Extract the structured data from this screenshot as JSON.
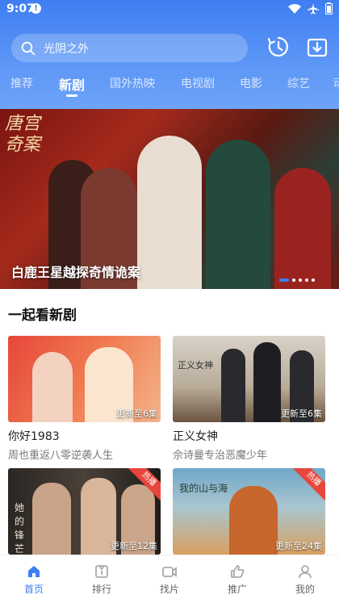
{
  "status": {
    "time": "9:07",
    "notif_glyph": "!"
  },
  "search": {
    "placeholder": "光阴之外"
  },
  "header_icons": [
    "history-icon",
    "download-icon"
  ],
  "tabs": [
    {
      "label": "推荐"
    },
    {
      "label": "新剧"
    },
    {
      "label": "国外热映"
    },
    {
      "label": "电视剧"
    },
    {
      "label": "电影"
    },
    {
      "label": "综艺"
    },
    {
      "label": "动"
    }
  ],
  "active_tab": "新剧",
  "banner": {
    "caption": "白鹿王星越探奇情诡案",
    "calligraphy": "唐宫奇案",
    "page_count": 5,
    "active_page": 1
  },
  "section": {
    "title": "一起看新剧"
  },
  "cards": [
    {
      "name": "你好1983",
      "desc": "周也重返八零逆袭人生",
      "update": "更新至6集",
      "hot": false,
      "mark": ""
    },
    {
      "name": "正义女神",
      "desc": "佘诗曼专治恶魔少年",
      "update": "更新至6集",
      "hot": false,
      "mark": "正义女神"
    },
    {
      "name": "",
      "desc": "",
      "update": "更新至12集",
      "hot": true,
      "hot_label": "热播",
      "mark": "她的锋芒"
    },
    {
      "name": "",
      "desc": "",
      "update": "更新至24集",
      "hot": true,
      "hot_label": "热播",
      "mark": "我的山与海"
    }
  ],
  "bottom_nav": [
    {
      "label": "首页",
      "icon": "home-icon",
      "active": true
    },
    {
      "label": "排行",
      "icon": "ranking-icon",
      "active": false
    },
    {
      "label": "找片",
      "icon": "video-icon",
      "active": false
    },
    {
      "label": "推广",
      "icon": "thumbs-up-icon",
      "active": false
    },
    {
      "label": "我的",
      "icon": "user-icon",
      "active": false
    }
  ],
  "colors": {
    "accent": "#3f7ef2",
    "hot": "#e8453c"
  }
}
